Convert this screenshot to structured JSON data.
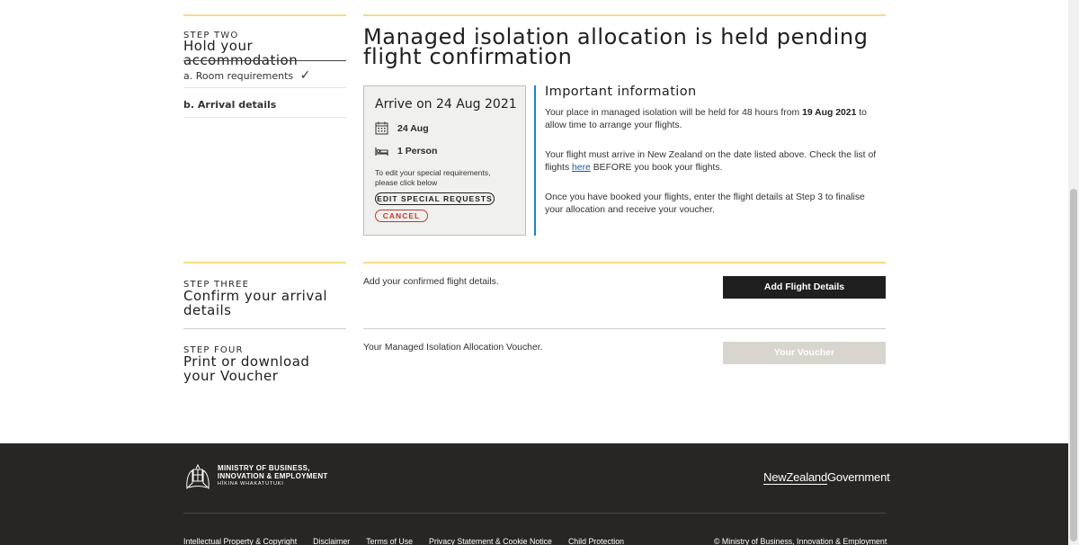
{
  "steps": {
    "two": {
      "label": "STEP TWO",
      "title": "Hold your accommodation",
      "sub_a": "a. Room requirements",
      "sub_b": "b. Arrival details"
    },
    "three": {
      "label": "STEP THREE",
      "title": "Confirm your arrival details"
    },
    "four": {
      "label": "STEP FOUR",
      "title": "Print or download your Voucher"
    }
  },
  "main": {
    "heading": "Managed isolation allocation is held pending flight confirmation",
    "card": {
      "arrive": "Arrive on 24 Aug 2021",
      "date": "24 Aug",
      "persons": "1 Person",
      "note": "To edit your special requirements, please click below",
      "edit_button": "EDIT SPECIAL REQUESTS",
      "cancel_button": "CANCEL"
    },
    "info": {
      "title": "Important information",
      "p1_before": "Your place in managed isolation will be held for 48 hours from ",
      "p1_bold": "19 Aug 2021",
      "p1_after": " to allow time to arrange your flights.",
      "p2_before": "Your flight must arrive in New Zealand on the date listed above. Check the list of flights ",
      "p2_link": "here",
      "p2_after": " BEFORE you book your flights.",
      "p3": "Once you have booked your flights, enter the flight details at Step 3 to finalise your allocation and receive your voucher."
    },
    "step3_text": "Add your confirmed flight details.",
    "step3_button": "Add Flight Details",
    "step4_text": "Your Managed Isolation Allocation Voucher.",
    "step4_button": "Your Voucher"
  },
  "footer": {
    "mbie_line1": "MINISTRY OF BUSINESS,",
    "mbie_line2": "INNOVATION & EMPLOYMENT",
    "mbie_line3": "HĪKINA WHAKATUTUKI",
    "nz_govt_nz": "NewZealand",
    "nz_govt_govt": "Government",
    "links": [
      "Intellectual Property & Copyright",
      "Disclaimer",
      "Terms of Use",
      "Privacy Statement & Cookie Notice",
      "Child Protection"
    ],
    "copyright": "© Ministry of Business, Innovation & Employment"
  },
  "colors": {
    "accent_gold": "#f2dc87",
    "info_blue": "#1a84c8",
    "cancel_red": "#c0392b",
    "footer_bg": "#272625"
  }
}
